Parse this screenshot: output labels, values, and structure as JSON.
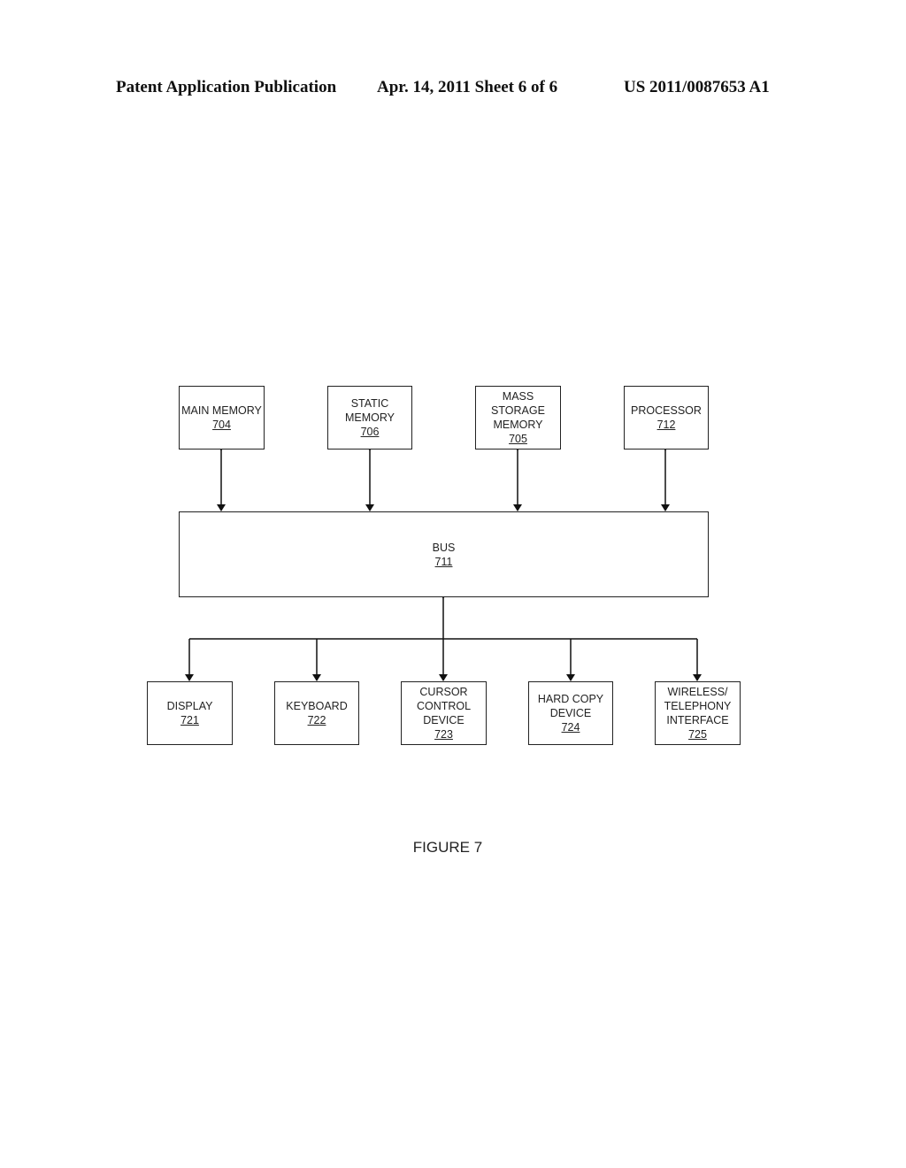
{
  "header": {
    "left": "Patent Application Publication",
    "middle": "Apr. 14, 2011  Sheet 6 of 6",
    "right": "US 2011/0087653 A1"
  },
  "figure": {
    "caption": "FIGURE 7",
    "top_row": [
      {
        "label": "MAIN MEMORY",
        "ref": "704"
      },
      {
        "label": "STATIC\nMEMORY",
        "ref": "706"
      },
      {
        "label": "MASS STORAGE\nMEMORY",
        "ref": "705"
      },
      {
        "label": "PROCESSOR",
        "ref": "712"
      }
    ],
    "bus": {
      "label": "BUS",
      "ref": "711"
    },
    "bottom_row": [
      {
        "label": "DISPLAY",
        "ref": "721"
      },
      {
        "label": "KEYBOARD",
        "ref": "722"
      },
      {
        "label": "CURSOR\nCONTROL\nDEVICE",
        "ref": "723"
      },
      {
        "label": "HARD COPY\nDEVICE",
        "ref": "724"
      },
      {
        "label": "WIRELESS/\nTELEPHONY\nINTERFACE",
        "ref": "725"
      }
    ]
  }
}
